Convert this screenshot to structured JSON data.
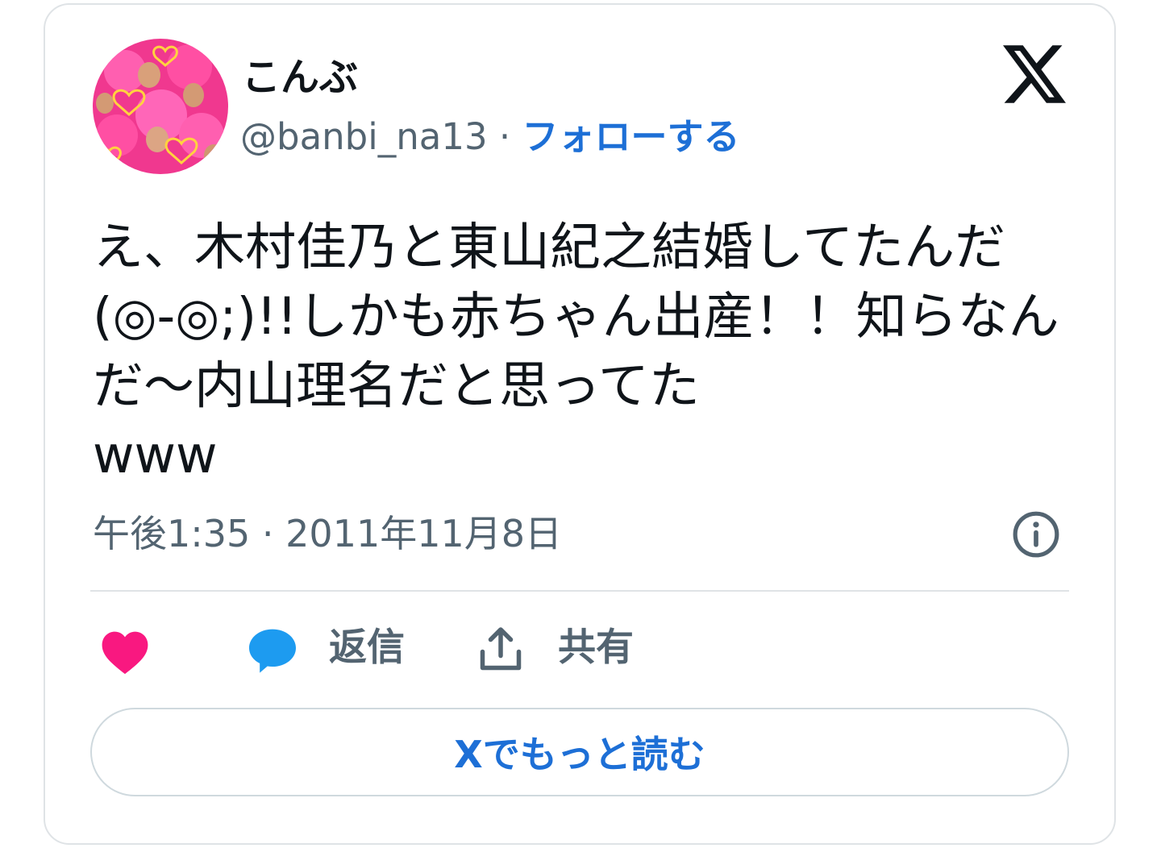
{
  "tweet": {
    "display_name": "こんぶ",
    "handle": "@banbi_na13",
    "separator": " · ",
    "follow_label": "フォローする",
    "text": "え、木村佳乃と東山紀之結婚してたんだ(◎-◎;)!!しかも赤ちゃん出産！！知らなんだ〜内山理名だと思ってた\nwww",
    "timestamp": "午後1:35 · 2011年11月8日"
  },
  "actions": {
    "like_count": "",
    "reply_label": "返信",
    "share_label": "共有"
  },
  "read_more_label": "Xでもっと読む",
  "icons": [
    "x-logo-icon",
    "info-icon",
    "heart-icon",
    "reply-bubble-icon",
    "share-icon"
  ],
  "colors": {
    "link_blue": "#1d6fd6",
    "heart_pink": "#f91880",
    "reply_blue": "#1d9bf0",
    "secondary_text": "#536471"
  }
}
